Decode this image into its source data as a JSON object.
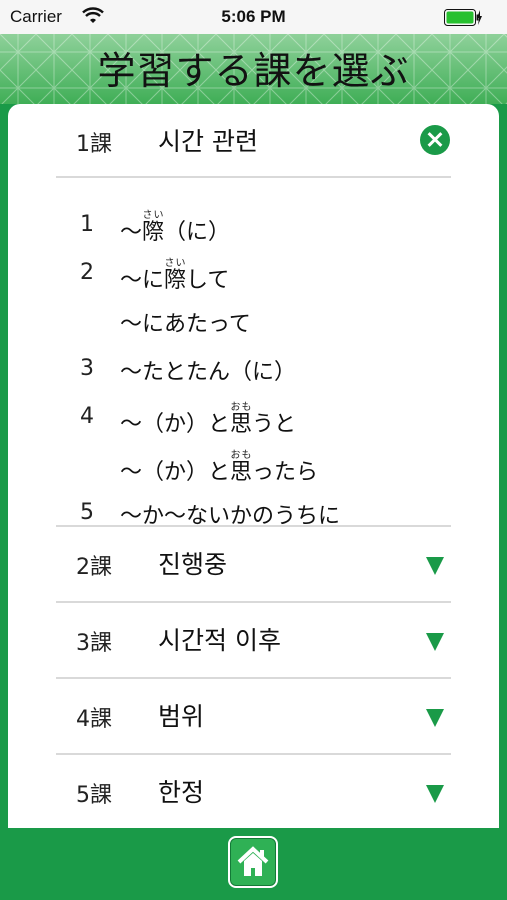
{
  "status": {
    "carrier": "Carrier",
    "time": "5:06 PM"
  },
  "header": {
    "title": "学習する課を選ぶ"
  },
  "expanded": {
    "number": "1課",
    "title": "시간 관련",
    "items": [
      {
        "num": "1",
        "pre": "～",
        "base": "際",
        "ruby": "さい",
        "post": "（に）"
      },
      {
        "num": "2",
        "pre": "～に",
        "base": "際",
        "ruby": "さい",
        "post": "して"
      },
      {
        "num": "",
        "pre": "～にあたって",
        "base": "",
        "ruby": "",
        "post": ""
      },
      {
        "num": "3",
        "pre": "～たとたん（に）",
        "base": "",
        "ruby": "",
        "post": ""
      },
      {
        "num": "4",
        "pre": "～（か）と",
        "base": "思",
        "ruby": "おも",
        "post": "うと"
      },
      {
        "num": "",
        "pre": "～（か）と",
        "base": "思",
        "ruby": "おも",
        "post": "ったら"
      },
      {
        "num": "5",
        "pre": "～か～ないかのうちに",
        "base": "",
        "ruby": "",
        "post": ""
      }
    ]
  },
  "lessons": [
    {
      "number": "2課",
      "title": "진행중"
    },
    {
      "number": "3課",
      "title": "시간적 이후"
    },
    {
      "number": "4課",
      "title": "범위"
    },
    {
      "number": "5課",
      "title": "한정"
    }
  ],
  "colors": {
    "brand_green": "#1a9a48",
    "header_light": "#8fd19a"
  },
  "icons": {
    "collapse": "close-circle-icon",
    "expand": "triangle-down-icon",
    "home": "home-icon"
  }
}
